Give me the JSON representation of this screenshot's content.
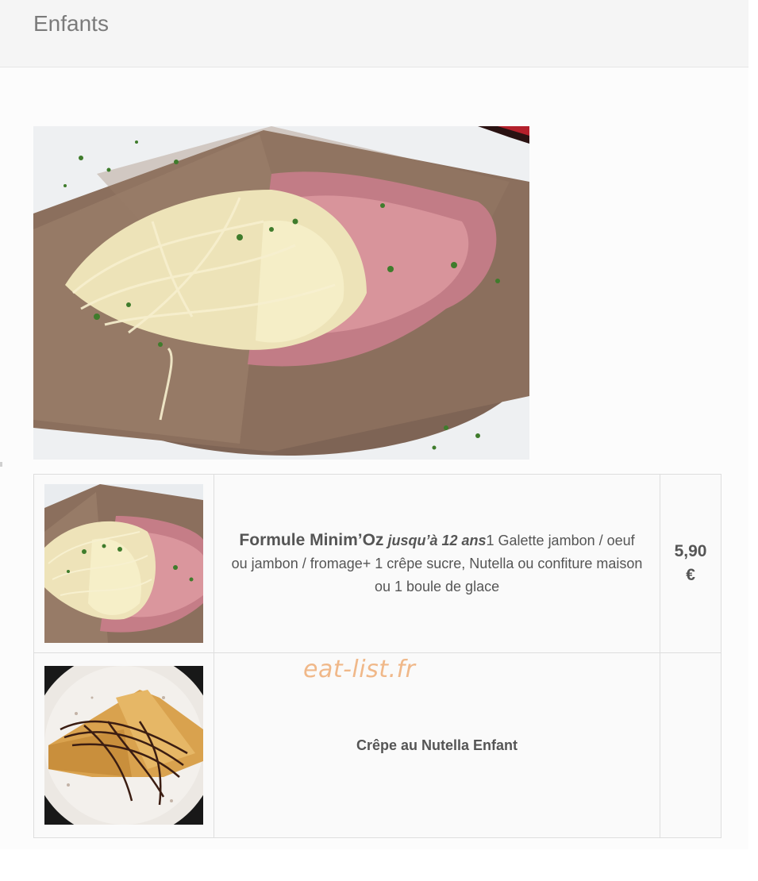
{
  "section": {
    "title": "Enfants"
  },
  "images": {
    "hero": "galette-jambon-fromage-photo",
    "thumb1": "galette-jambon-fromage-thumbnail",
    "thumb2": "crepe-nutella-thumbnail"
  },
  "items": [
    {
      "name": "Formule Minim’Oz",
      "age_note": "jusqu’à 12 ans",
      "description": "1 Galette jambon / oeuf ou jambon / fromage+ 1 crêpe sucre, Nutella ou confiture maison ou 1 boule de glace",
      "price_amount": "5,90",
      "price_currency": "€"
    },
    {
      "name": "Crêpe au Nutella Enfant",
      "price_amount": "",
      "price_currency": ""
    }
  ],
  "watermark": "eat-list.fr",
  "colors": {
    "header_bg": "#f5f5f5",
    "text": "#555555",
    "watermark": "#f0b889",
    "border": "#dedede"
  }
}
